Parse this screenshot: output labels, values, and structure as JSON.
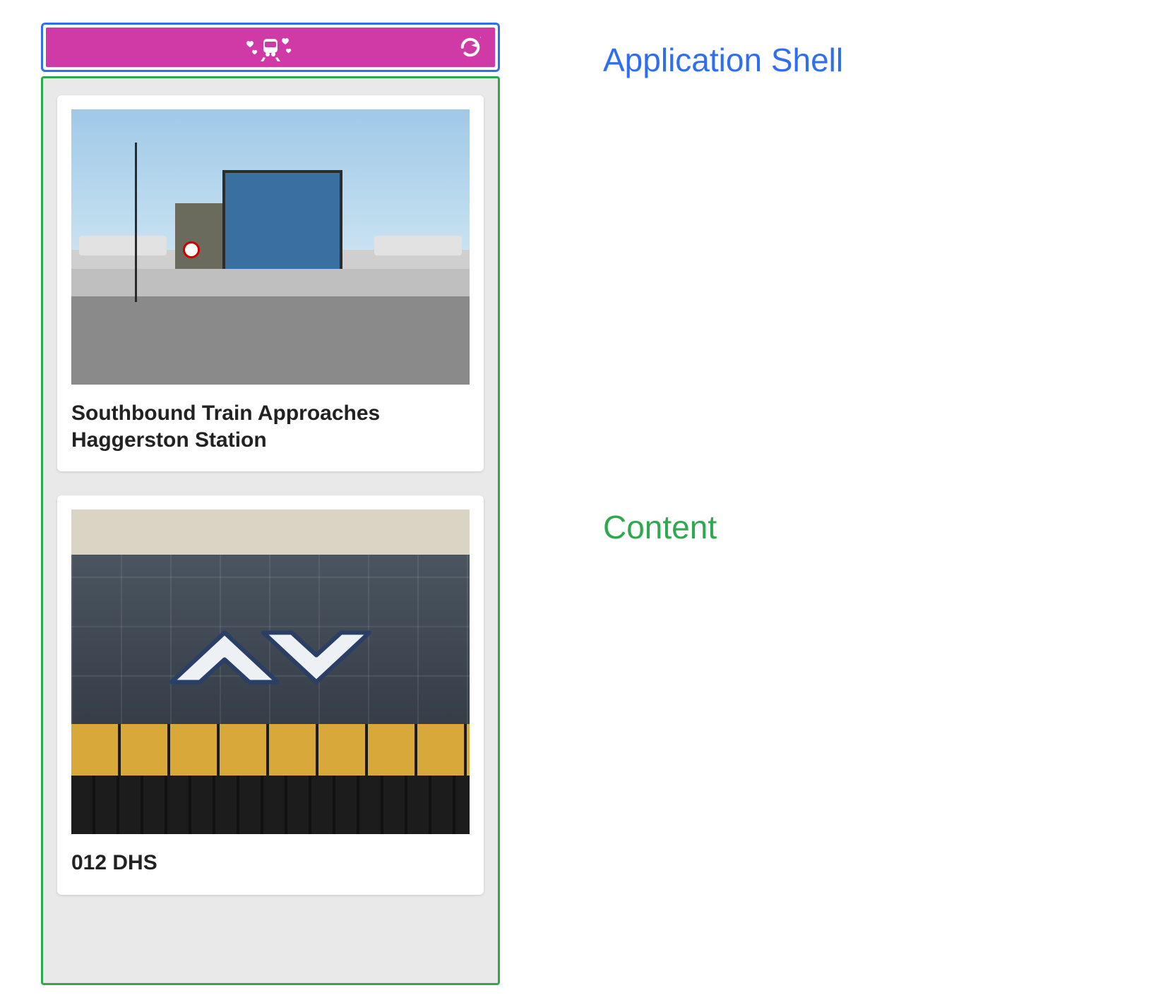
{
  "annotations": {
    "shell_label": "Application Shell",
    "content_label": "Content"
  },
  "colors": {
    "shell_outline": "#2f6ef0",
    "content_outline": "#2fa84f",
    "header_bg": "#d03aa7"
  },
  "app": {
    "header": {
      "logo_name": "train-hearts-icon",
      "refresh_name": "refresh-icon"
    },
    "cards": [
      {
        "title": "Southbound Train Approaches Haggerston Station"
      },
      {
        "title": "012 DHS"
      }
    ]
  }
}
